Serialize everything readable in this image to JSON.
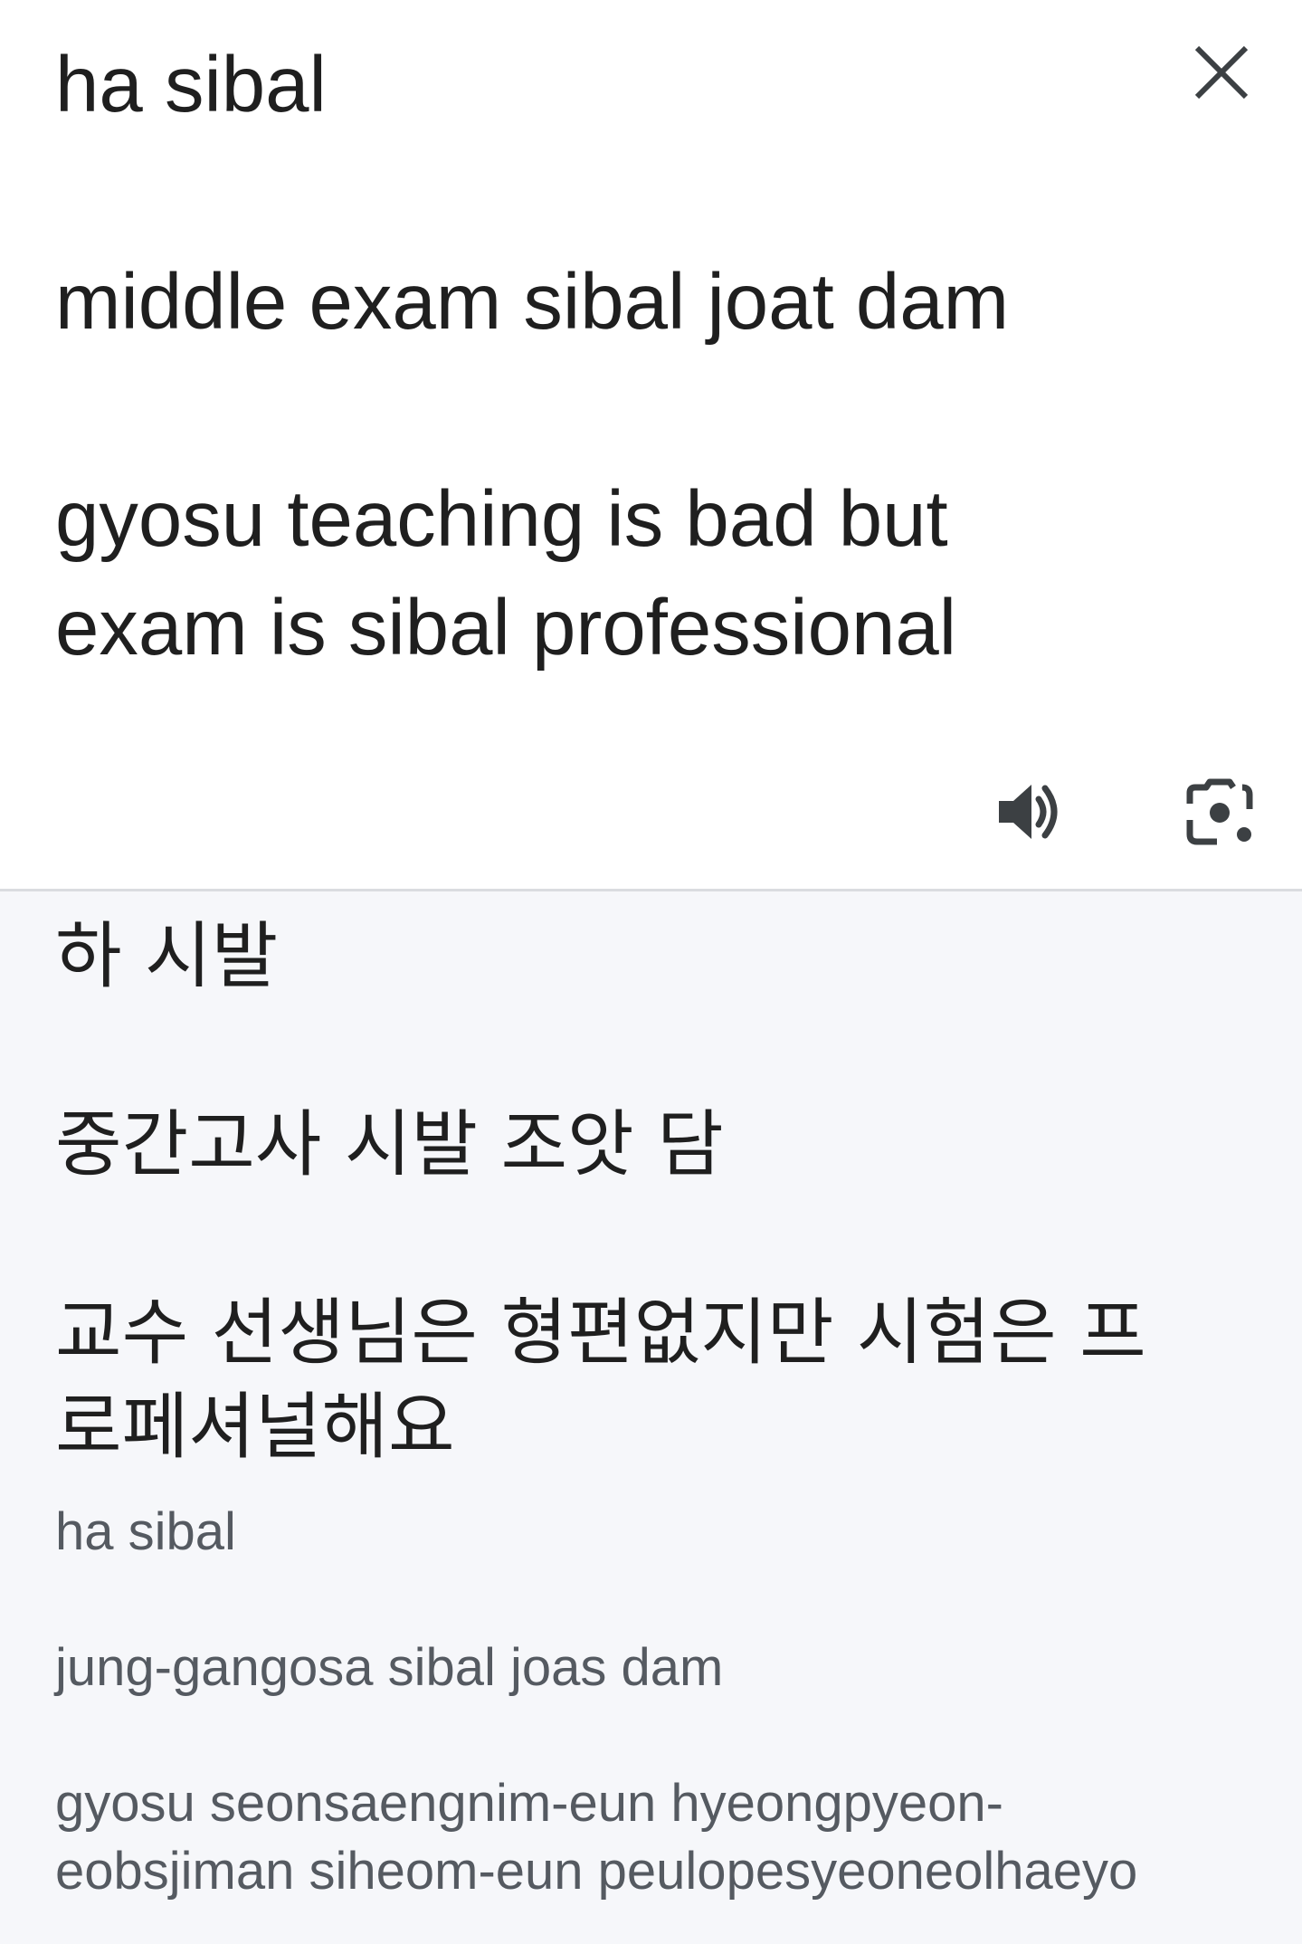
{
  "source": {
    "text": "ha sibal\n\nmiddle exam sibal joat dam\n\ngyosu teaching is bad but\nexam is sibal professional"
  },
  "actions": {
    "close_icon": "close-icon",
    "speaker_icon": "volume-up-icon",
    "lens_icon": "camera-lens-icon"
  },
  "result": {
    "translation": "하 시발\n\n중간고사 시발 조앗 담\n\n교수 선생님은 형편없지만 시험은 프\n로페셔널해요",
    "romanization": "ha sibal\n\njung-gangosa sibal joas dam\n\ngyosu seonsaengnim-eun hyeongpyeon-\neobsjiman siheom-eun peulopesyeoneolhaeyo"
  },
  "colors": {
    "text_primary": "#1f1f1f",
    "text_secondary": "#555a61",
    "result_background": "#f6f7fa",
    "divider": "#dadce0",
    "icon": "#3c4043"
  }
}
